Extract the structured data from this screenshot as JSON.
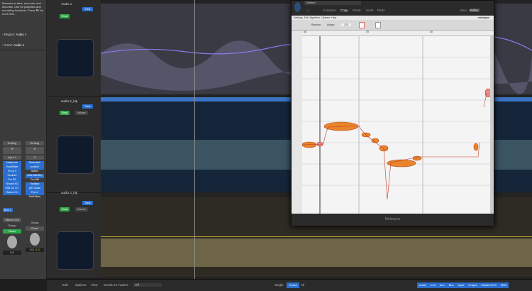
{
  "inspector": {
    "help_text": "Measure in bars, seconds, and seconds. Use for playback and recording functions. Press ⌘/ for more info.",
    "region_label": "Region:",
    "region_value": "Audio 1",
    "track_label": "Track:",
    "track_value": "Audio 1",
    "strips": [
      {
        "setting": "Setting",
        "input": "Input 1",
        "plugins": [
          "Noisecrue",
          "VocalRider",
          "Pro-Q 3",
          "Soothe2",
          "Pro-DS",
          "Bricasti M2",
          "SSB G2 377",
          "Waves H1"
        ],
        "send": "Bus 1",
        "stereo": "Stereo Out",
        "group": "Group",
        "read": "Read",
        "vol": "0.0",
        "pan": ""
      },
      {
        "setting": "Setting",
        "input": "",
        "plugins": [
          "Dimension",
          "soothe2",
          "Saturn",
          "Little AlterBoy",
          "Pro-MB",
          "Radiator",
          "AIR Guitar",
          "Pro-L2"
        ],
        "extra": "Stuff Minor",
        "group": "Group",
        "read": "Read",
        "vol": "0.0",
        "pan": "-2.0"
      }
    ]
  },
  "tracks": [
    {
      "name": "Audio 1",
      "track_btn": "Track",
      "read": "Read",
      "volume": "",
      "region": ""
    },
    {
      "name": "audio 2_bip",
      "track_btn": "Track",
      "read": "Read",
      "volume": "Volume",
      "region": "audio 1_bip_0 ⊙"
    },
    {
      "name": "audio 3_bip",
      "track_btn": "Track",
      "read": "Read",
      "volume": "Volume",
      "region": ""
    }
  ],
  "melodyne": {
    "title": "Untitled",
    "nav": [
      "Compare",
      "Copy",
      "Paste",
      "Undo",
      "Redo"
    ],
    "view_label": "View:",
    "view_value": "Editor",
    "menu": [
      "Settings",
      "Edit",
      "Algorithm",
      "Options",
      "Help"
    ],
    "brand": "melodyne",
    "tool_buttons": [
      "Random",
      "Assign",
      "120"
    ],
    "footer": "Melodyne",
    "ruler": [
      "38",
      "39",
      "40"
    ],
    "keys": [
      "C4",
      "B3",
      "A3",
      "G3",
      "F3",
      "E3",
      "D3",
      "C3"
    ]
  },
  "bottom": {
    "menu": [
      "Edit",
      "Options",
      "View"
    ],
    "sends_label": "Sends on Faders:",
    "sends_value": "Off",
    "modes": [
      "Single",
      "Tracks",
      "All"
    ],
    "active_mode": "Tracks",
    "filters": [
      "Audio",
      "Inst",
      "Aux",
      "Bus",
      "Input",
      "Output",
      "Master/VCA",
      "MIDI"
    ]
  },
  "colors": {
    "accent": "#2a6fd0",
    "green": "#2fa84a",
    "region_blue": "#3b74c4",
    "note": "#e8852a"
  }
}
